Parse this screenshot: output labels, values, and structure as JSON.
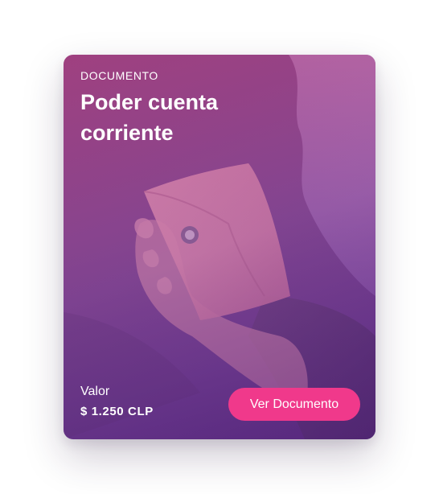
{
  "card": {
    "category": "DOCUMENTO",
    "title": "Poder cuenta corriente",
    "price_label": "Valor",
    "price_value": "$ 1.250 CLP",
    "button_label": "Ver Documento"
  },
  "colors": {
    "button": "#f0398b",
    "gradient_top": "#9a4784",
    "gradient_bottom": "#5b2f82",
    "text": "#ffffff"
  }
}
